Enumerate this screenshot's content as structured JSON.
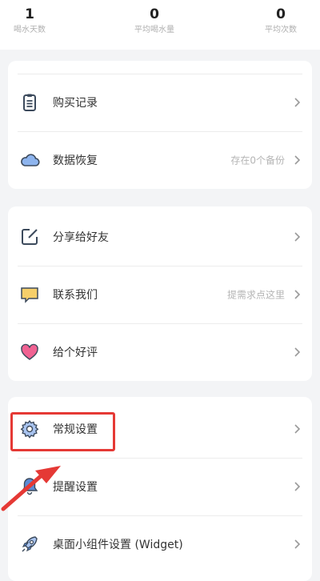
{
  "stats": [
    {
      "value": "1",
      "label": "喝水天数"
    },
    {
      "value": "0",
      "label": "平均喝水量"
    },
    {
      "value": "0",
      "label": "平均次数"
    }
  ],
  "menu": {
    "purchase_history": {
      "label": "购买记录",
      "icon": "clipboard-icon"
    },
    "data_restore": {
      "label": "数据恢复",
      "value": "存在0个备份",
      "icon": "cloud-icon"
    },
    "share": {
      "label": "分享给好友",
      "icon": "share-edit-icon"
    },
    "contact": {
      "label": "联系我们",
      "value": "提需求点这里",
      "icon": "message-icon"
    },
    "rate": {
      "label": "给个好评",
      "icon": "heart-icon"
    },
    "general_settings": {
      "label": "常规设置",
      "icon": "gear-icon"
    },
    "reminder_settings": {
      "label": "提醒设置",
      "icon": "bell-icon"
    },
    "widget_settings": {
      "label": "桌面小组件设置 (Widget)",
      "icon": "rocket-icon"
    }
  },
  "colors": {
    "accent_blue": "#5b8bd6",
    "highlight_red": "#e53935",
    "heart_pink": "#f06292",
    "message_yellow": "#f6cf6a"
  }
}
